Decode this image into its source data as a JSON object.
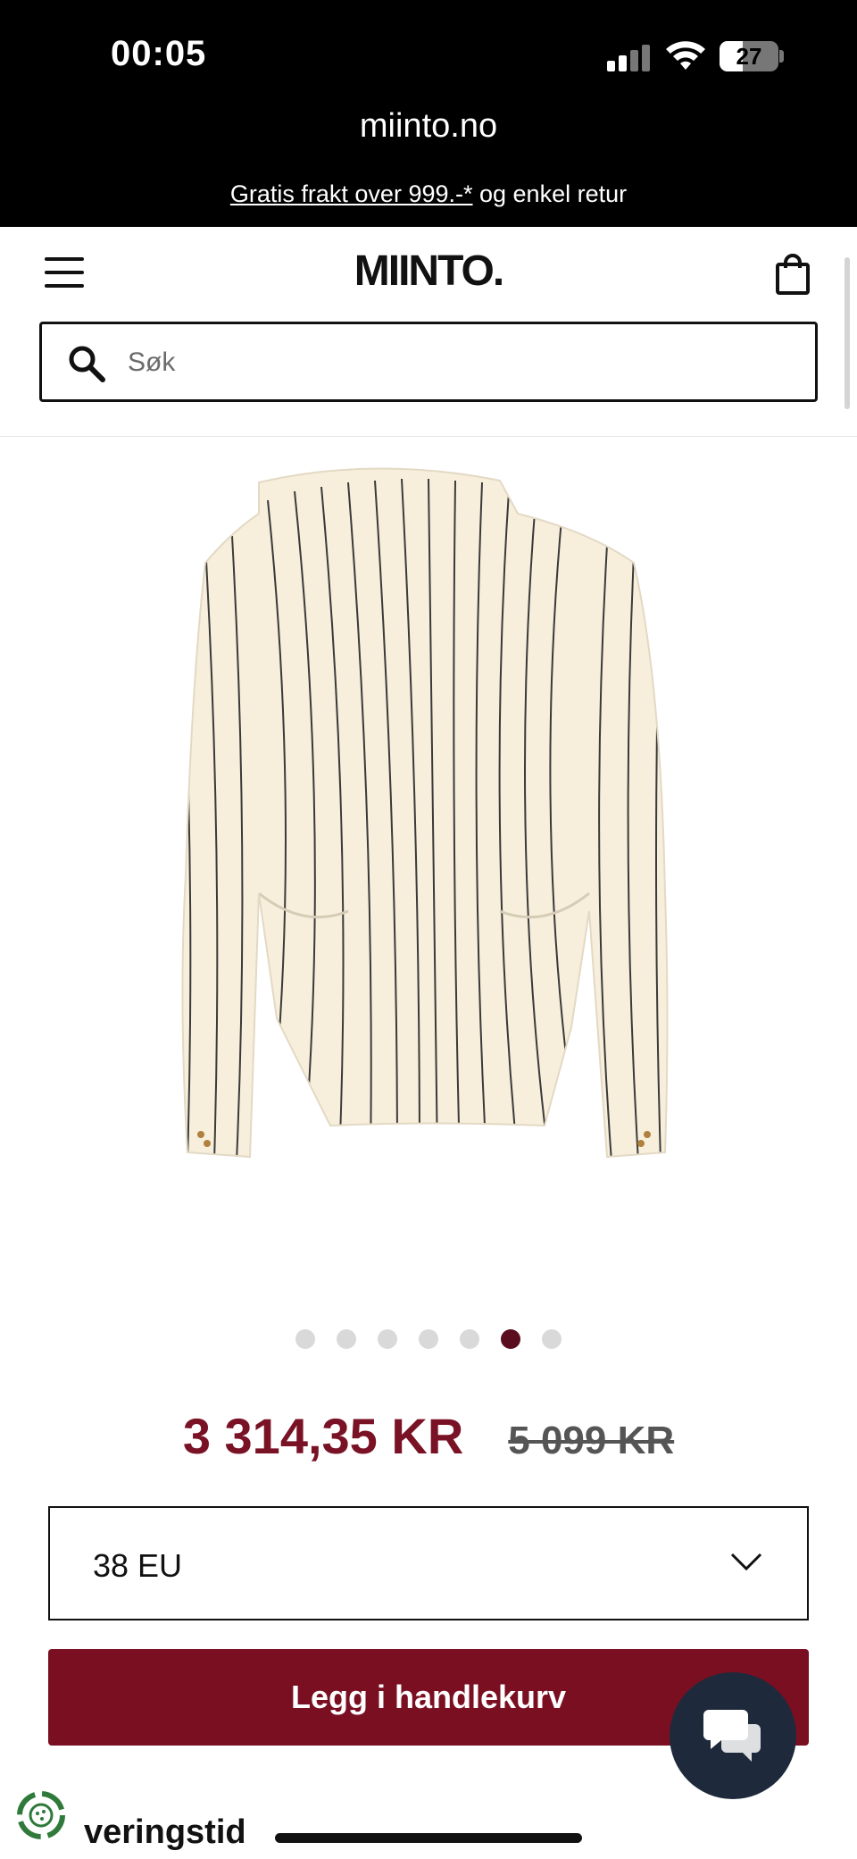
{
  "status_bar": {
    "time": "00:05",
    "battery": "27",
    "icons": [
      "signal-icon",
      "wifi-icon",
      "battery-icon"
    ]
  },
  "browser": {
    "url": "miinto.no"
  },
  "promo": {
    "link_text": "Gratis frakt over 999.-*",
    "rest_text": " og enkel retur"
  },
  "header": {
    "logo": "MIINTO.",
    "menu_icon": "hamburger-menu-icon",
    "cart_icon": "shopping-bag-icon"
  },
  "search": {
    "placeholder": "Søk",
    "icon": "search-icon"
  },
  "product": {
    "image_alt": "Cream pinstripe blazer, back view",
    "carousel": {
      "count": 7,
      "active_index": 5
    },
    "price_current": "3 314,35 KR",
    "price_original": "5 099 KR",
    "size_selected": "38 EU",
    "add_to_cart_label": "Legg i handlekurv"
  },
  "chat": {
    "icon": "chat-bubbles-icon"
  },
  "footer": {
    "partial_text": "veringstid",
    "icon": "recycle-icon"
  },
  "colors": {
    "accent": "#7a0f22",
    "price": "#7a1226",
    "dot_active": "#5a0d1e",
    "chat_bg": "#1e2a3b"
  }
}
